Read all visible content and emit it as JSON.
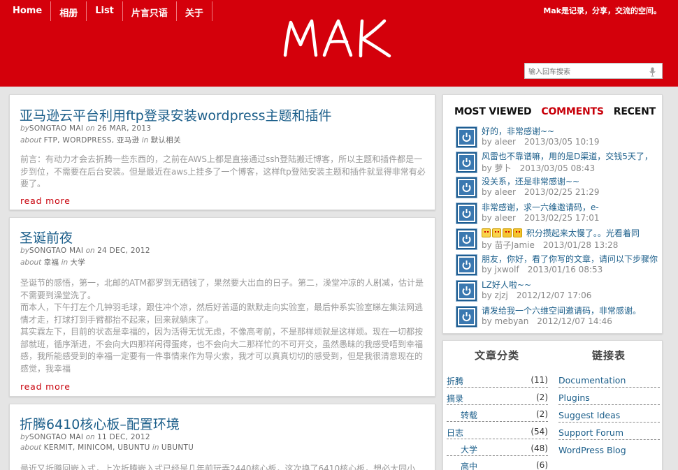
{
  "nav": [
    "Home",
    "相册",
    "List",
    "片言只语",
    "关于"
  ],
  "site": {
    "logo": "MAK",
    "tagline": "Mak是记录，分享，交流的空间。",
    "search_placeholder": "输入回车搜索"
  },
  "posts": [
    {
      "title": "亚马逊云平台利用ftp登录安装wordpress主题和插件",
      "by": "by",
      "author": "SONGTAO MAI",
      "on": "on",
      "date": "26 MAR, 2013",
      "about": "about",
      "tags": "FTP, WORDPRESS, 亚马逊",
      "in": "in",
      "category": "默认相关",
      "excerpt": "前言：有动力才会去折腾一些东西的，之前在AWS上都是直接通过ssh登陆搬迁博客，所以主题和插件都是一步到位，不需要在后台安装。但是最近在aws上挂多了一个博客，这样ftp登陆安装主题和插件就显得非常有必要了。",
      "read_more": "read more"
    },
    {
      "title": "圣诞前夜",
      "by": "by",
      "author": "SONGTAO MAI",
      "on": "on",
      "date": "24 DEC, 2012",
      "about": "about",
      "tags": "幸福",
      "in": "in",
      "category": "大学",
      "excerpt": "圣诞节的感悟，第一，北邮的ATM都罗到无硒钱了，果然要大出血的日子。第二，澡堂冲凉的人剧减，估计是不需要到澡堂洗了。\n而本人，下午打左个几钟羽毛球，跟住冲个凉，然后好苦逼的默默走向实验室，最后仲系实验室睇左集法网逃情才走，打球打到手臂都抬不起来，回来就躺床了。\n其实霖左下，目前的状态是幸福的，因为活得无忧无虑，不像高考前，不是那样烦就是这样烦。现在一切都按部就班，循序渐进，不会向大四那样闲得蛋疼，也不会向大二那样忙的不可开交，虽然愚昧的我感受唔到幸福感，我所能感受到的幸福一定要有一件事情来作为导火索，我才可以真真切切的感受到，但是我很清意现在的感觉，我幸福",
      "read_more": "read more"
    },
    {
      "title": "折腾6410核心板–配置环境",
      "by": "by",
      "author": "SONGTAO MAI",
      "on": "on",
      "date": "11 DEC, 2012",
      "about": "about",
      "tags": "KERMIT, MINICOM, UBUNTU",
      "in": "in",
      "category": "UBUNTU",
      "excerpt": "最近又折腾回嵌入式，上次折腾嵌入式已经是几年前玩弄2440核心板，这次换了6410核心板，想必大同小"
    }
  ],
  "tabs": [
    "MOST VIEWED",
    "COMMENTS",
    "RECENT"
  ],
  "comments": [
    {
      "text": "好的，非常感谢~~",
      "by": "by",
      "user": "aleer",
      "date": "2013/03/05 10:19"
    },
    {
      "text": "风雷也不靠谱嘛，用的是D渠道，交钱5天了，",
      "by": "by",
      "user": "萝卜",
      "date": "2013/03/05 08:43"
    },
    {
      "text": "没关系，还是非常感谢~~",
      "by": "by",
      "user": "aleer",
      "date": "2013/02/25 21:29"
    },
    {
      "text": "非常感谢，求一六维邀请码，e-",
      "by": "by",
      "user": "aleer",
      "date": "2013/02/25 17:01"
    },
    {
      "text": "积分攒起来太慢了。。光看着同",
      "by": "by",
      "user": "苗子Jamie",
      "date": "2013/01/28 13:28"
    },
    {
      "text": "朋友，你好，看了你写的文章，请问以下步骤你",
      "by": "by",
      "user": "jxwolf",
      "date": "2013/01/16 08:53"
    },
    {
      "text": "LZ好人啦~~",
      "by": "by",
      "user": "zjzj",
      "date": "2012/12/07 17:06"
    },
    {
      "text": "请发给我一个六维空间邀请码，非常感谢。",
      "by": "by",
      "user": "mebyan",
      "date": "2012/12/07 14:46"
    }
  ],
  "categories_title": "文章分类",
  "categories": [
    {
      "name": "折腾",
      "count": "(11)",
      "indent": false
    },
    {
      "name": "摘录",
      "count": "(2)",
      "indent": false
    },
    {
      "name": "转载",
      "count": "(2)",
      "indent": true
    },
    {
      "name": "日志",
      "count": "(54)",
      "indent": false
    },
    {
      "name": "大学",
      "count": "(48)",
      "indent": true
    },
    {
      "name": "高中",
      "count": "(6)",
      "indent": true
    }
  ],
  "links_title": "链接表",
  "links": [
    "Documentation",
    "Plugins",
    "Suggest Ideas",
    "Support Forum",
    "WordPress Blog"
  ],
  "colors": {
    "header": "#d4000b",
    "link": "#1b5e8a",
    "accent": "#c8000a"
  }
}
